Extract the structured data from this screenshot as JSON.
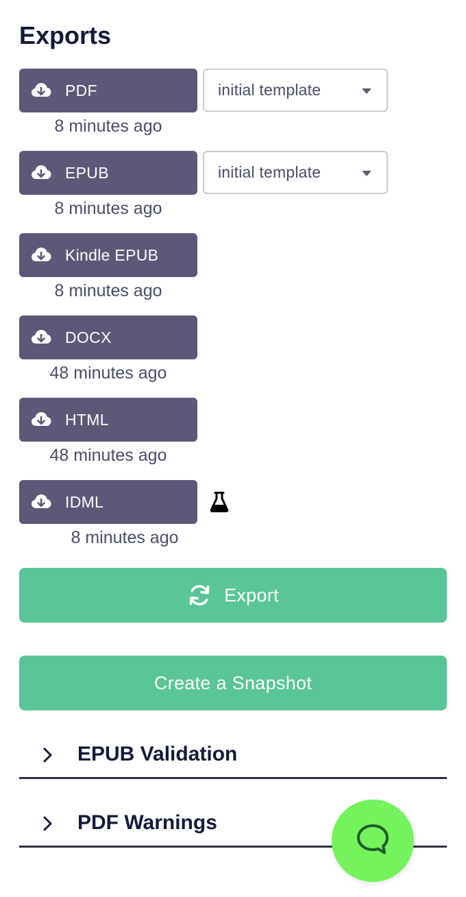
{
  "title": "Exports",
  "exports": [
    {
      "format": "PDF",
      "time": "8 minutes ago",
      "template": "initial template"
    },
    {
      "format": "EPUB",
      "time": "8 minutes ago",
      "template": "initial template"
    },
    {
      "format": "Kindle EPUB",
      "time": "8 minutes ago"
    },
    {
      "format": "DOCX",
      "time": "48 minutes ago"
    },
    {
      "format": "HTML",
      "time": "48 minutes ago"
    },
    {
      "format": "IDML",
      "time": "8 minutes ago",
      "badge_icon": "flask-icon"
    }
  ],
  "actions": {
    "export_label": "Export",
    "snapshot_label": "Create a Snapshot"
  },
  "sections": [
    {
      "label": "EPUB Validation"
    },
    {
      "label": "PDF Warnings"
    }
  ],
  "icons": {
    "download": "cloud-download-icon",
    "export": "sync-icon",
    "section": "chevron-right-icon",
    "chat": "chat-bubble-icon"
  },
  "colors": {
    "download_button": "#5c5877",
    "action_button": "#5ac597",
    "chat_button": "#74f35c",
    "heading": "#15193a"
  }
}
